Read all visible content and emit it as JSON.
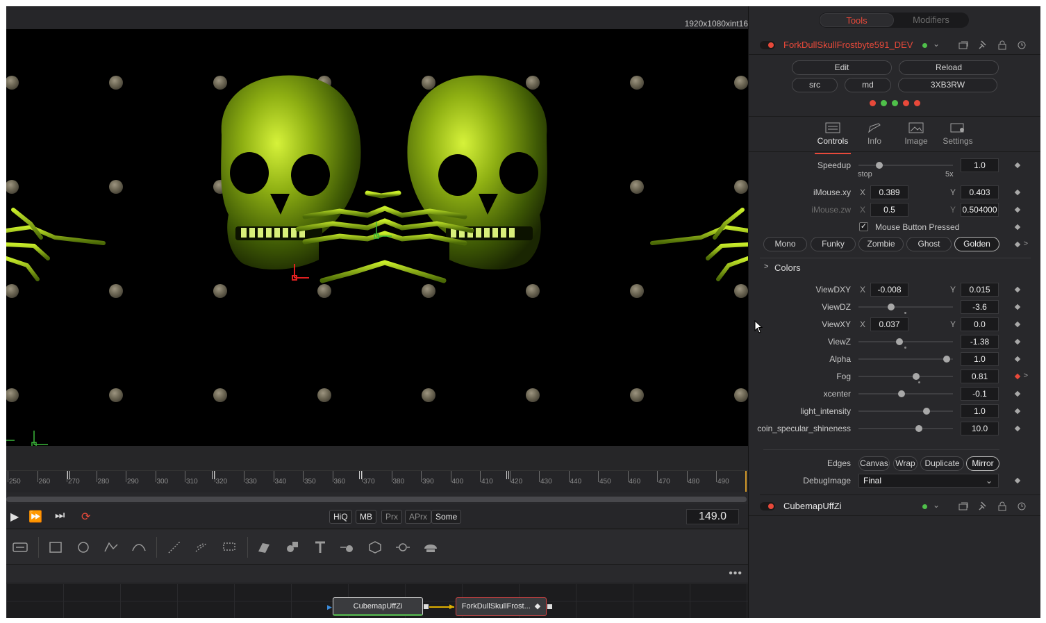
{
  "viewer": {
    "resolution": "1920x1080xint16",
    "ruler_ticks": [
      "250",
      "260",
      "270",
      "280",
      "290",
      "300",
      "310",
      "320",
      "330",
      "340",
      "350",
      "360",
      "370",
      "380",
      "390",
      "400",
      "410",
      "420",
      "430",
      "440",
      "450",
      "460",
      "470",
      "480",
      "490"
    ],
    "current_frame": "149.0"
  },
  "transport": {
    "play_icon": "play-icon",
    "quality_buttons": [
      "HiQ",
      "MB",
      "Prx",
      "APrx",
      "Some"
    ]
  },
  "flow": {
    "nodes": [
      "CubemapUffZi",
      "ForkDullSkullFrost..."
    ]
  },
  "panel": {
    "tabs": {
      "tools": "Tools",
      "modifiers": "Modifiers"
    },
    "tool_name": "ForkDullSkullFrostbyte591_DEV",
    "buttons": {
      "edit": "Edit",
      "reload": "Reload",
      "src": "src",
      "md": "md",
      "code": "3XB3RW"
    },
    "led_colors": [
      "#e8493a",
      "#4fc04a",
      "#4fc04a",
      "#e8493a",
      "#e8493a"
    ],
    "inspector_tabs": [
      "Controls",
      "Info",
      "Image",
      "Settings"
    ],
    "speedup": {
      "label": "Speedup",
      "value": "1.0",
      "min_label": "stop",
      "max_label": "5x",
      "level": 0.2
    },
    "imouse_xy": {
      "label": "iMouse.xy",
      "x": "0.389",
      "y": "0.403"
    },
    "imouse_zw": {
      "label": "iMouse.zw",
      "x": "0.5",
      "y": "0.504000"
    },
    "mouse_pressed": {
      "label": "Mouse Button Pressed",
      "checked": "✓"
    },
    "presets": [
      "Mono",
      "Funky",
      "Zombie",
      "Ghost",
      "Golden"
    ],
    "colors_section": "Colors",
    "view_dxy": {
      "label": "ViewDXY",
      "x": "-0.008",
      "y": "0.015"
    },
    "view_dz": {
      "label": "ViewDZ",
      "value": "-3.6",
      "level": 0.33
    },
    "view_xy": {
      "label": "ViewXY",
      "x": "0.037",
      "y": "0.0"
    },
    "view_z": {
      "label": "ViewZ",
      "value": "-1.38",
      "level": 0.43
    },
    "alpha": {
      "label": "Alpha",
      "value": "1.0",
      "level": 0.97
    },
    "fog": {
      "label": "Fog",
      "value": "0.81",
      "level": 0.62
    },
    "xcenter": {
      "label": "xcenter",
      "value": "-0.1",
      "level": 0.45
    },
    "light_intensity": {
      "label": "light_intensity",
      "value": "1.0",
      "level": 0.74
    },
    "coin_specular": {
      "label": "coin_specular_shineness",
      "value": "10.0",
      "level": 0.65
    },
    "edges": {
      "label": "Edges",
      "options": [
        "Canvas",
        "Wrap",
        "Duplicate",
        "Mirror"
      ]
    },
    "debug_image": {
      "label": "DebugImage",
      "value": "Final"
    },
    "second_tool": "CubemapUffZi",
    "accent": "#e8493a"
  }
}
